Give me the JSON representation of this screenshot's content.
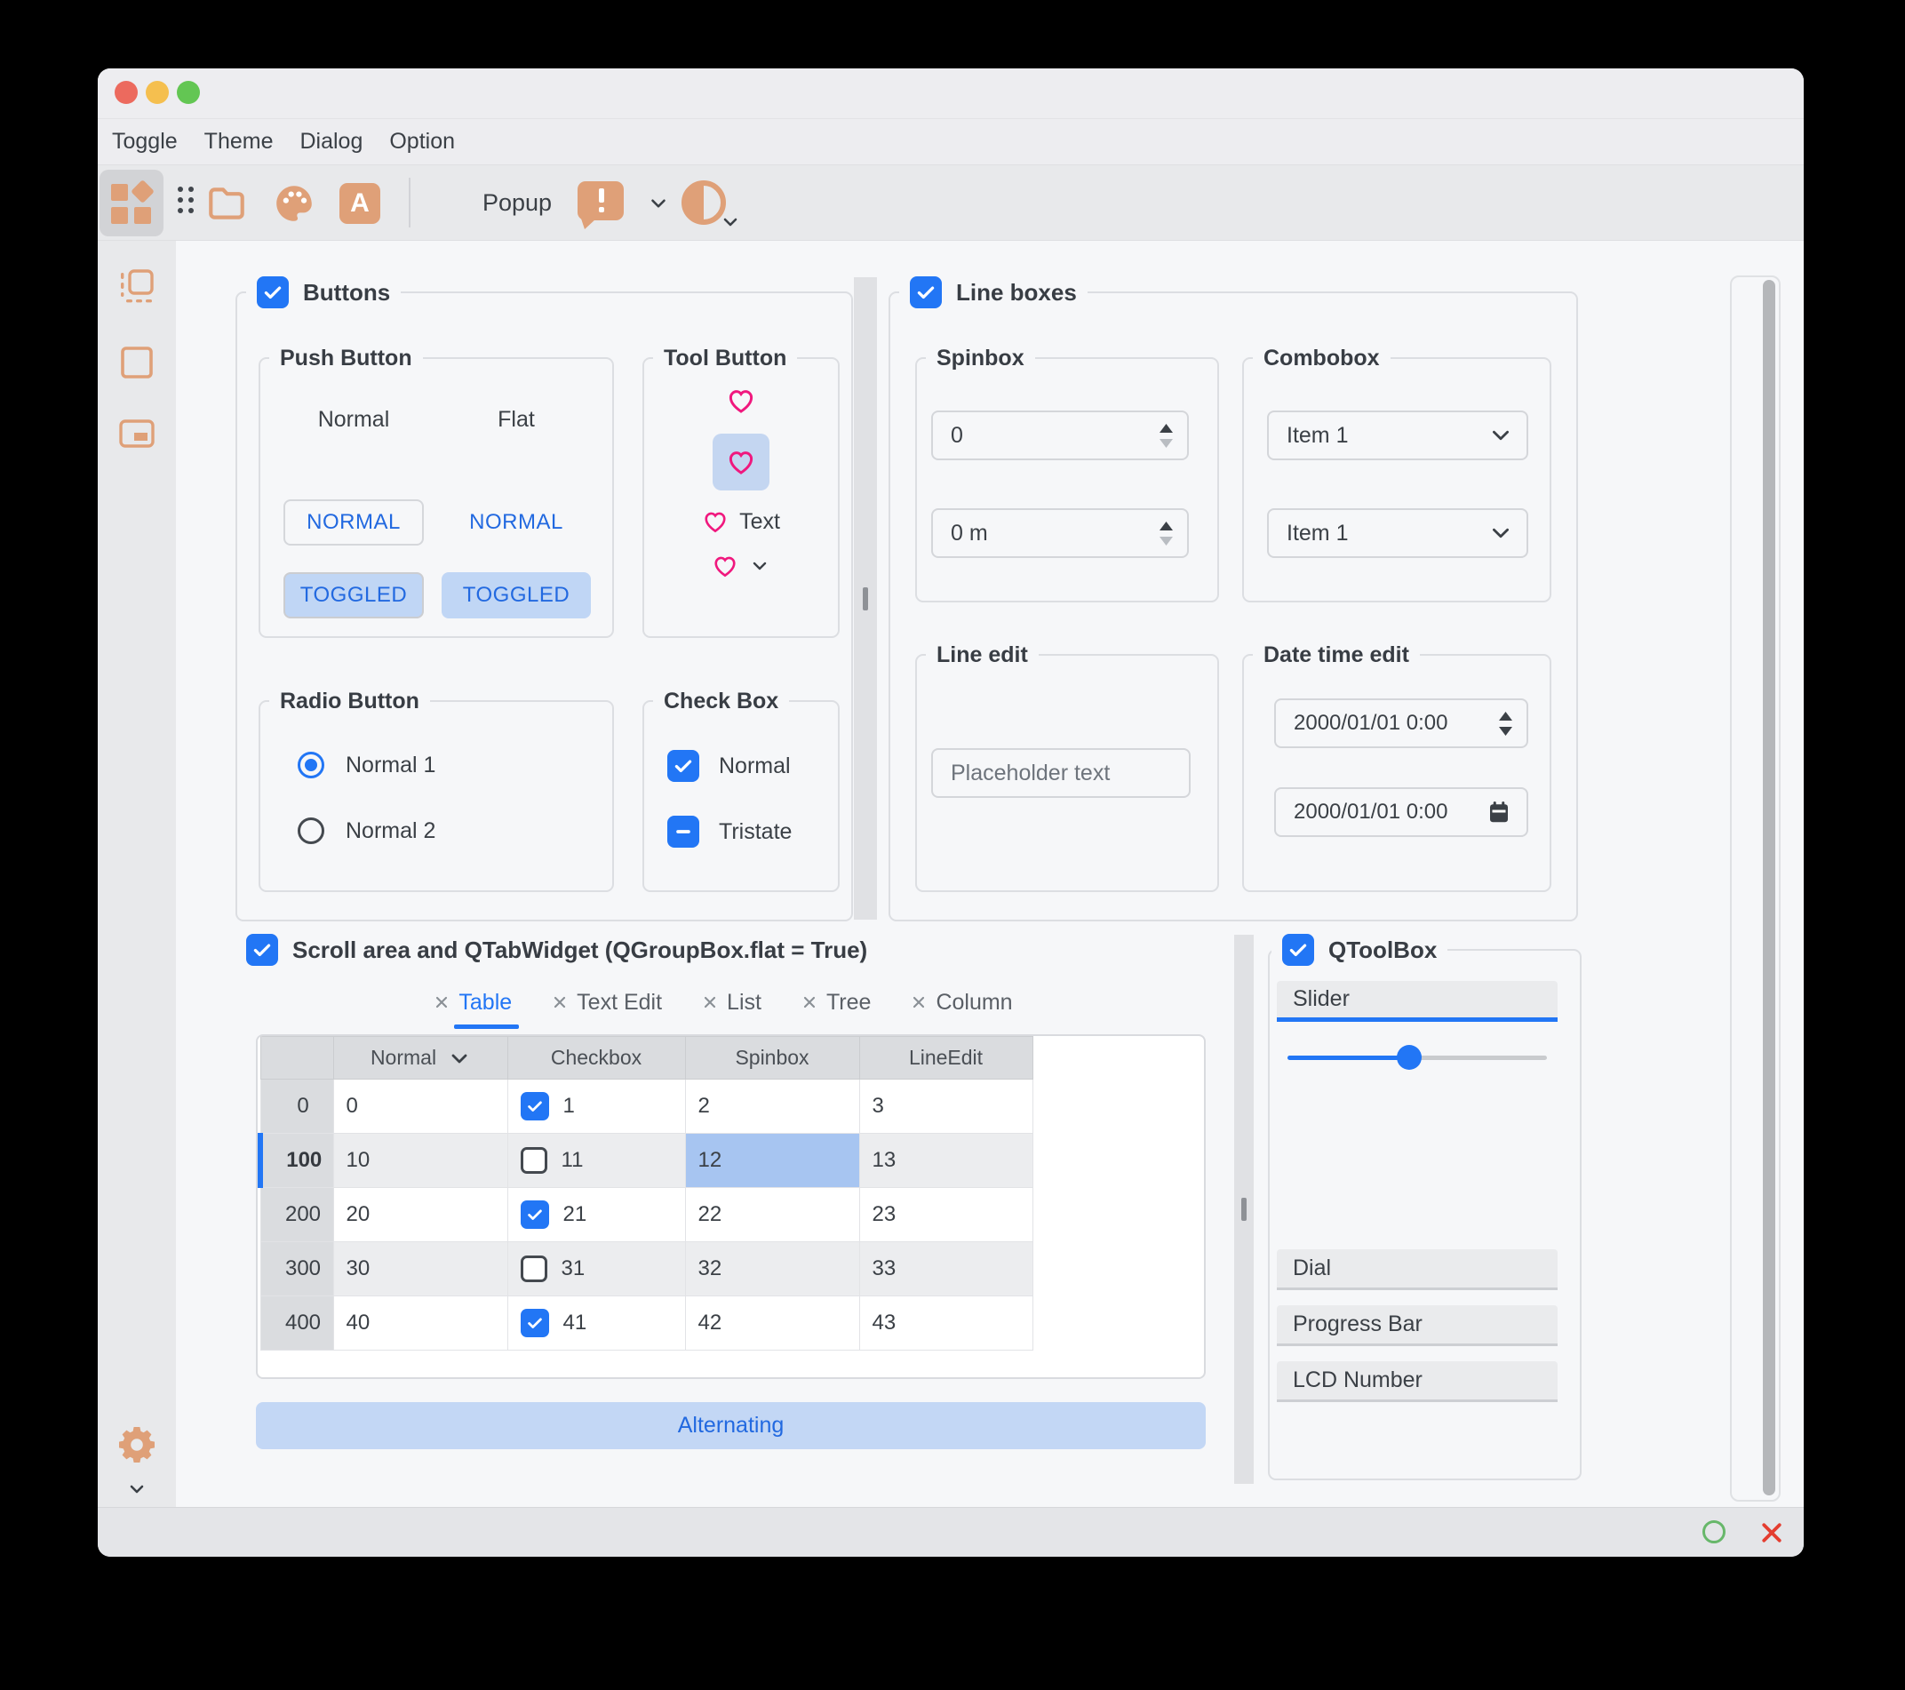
{
  "menubar": {
    "items": [
      "Toggle",
      "Theme",
      "Dialog",
      "Option"
    ]
  },
  "toolbar": {
    "popup_label": "Popup",
    "font_icon_letter": "A"
  },
  "buttons_group": {
    "title": "Buttons",
    "push_button": {
      "title": "Push Button",
      "normal_label": "Normal",
      "flat_label": "Flat",
      "normal_button": "NORMAL",
      "normal_flat_button": "NORMAL",
      "toggled_button": "TOGGLED",
      "toggled_flat_button": "TOGGLED"
    },
    "tool_button": {
      "title": "Tool Button",
      "text_button_label": "Text"
    },
    "radio_button": {
      "title": "Radio Button",
      "option_1": "Normal 1",
      "option_2": "Normal 2"
    },
    "check_box": {
      "title": "Check Box",
      "normal_label": "Normal",
      "tristate_label": "Tristate"
    }
  },
  "line_boxes_group": {
    "title": "Line boxes",
    "spinbox": {
      "title": "Spinbox",
      "value_1": "0",
      "value_2": "0 m"
    },
    "combobox": {
      "title": "Combobox",
      "value_1": "Item 1",
      "value_2": "Item 1"
    },
    "line_edit": {
      "title": "Line edit",
      "placeholder": "Placeholder text"
    },
    "date_time_edit": {
      "title": "Date time edit",
      "value_1": "2000/01/01 0:00",
      "value_2": "2000/01/01 0:00"
    }
  },
  "scroll_group": {
    "title": "Scroll area and QTabWidget (QGroupBox.flat = True)",
    "tabs": [
      {
        "label": "Table",
        "active": true
      },
      {
        "label": "Text Edit",
        "active": false
      },
      {
        "label": "List",
        "active": false
      },
      {
        "label": "Tree",
        "active": false
      },
      {
        "label": "Column",
        "active": false
      }
    ],
    "table": {
      "columns": [
        "Normal",
        "Checkbox",
        "Spinbox",
        "LineEdit"
      ],
      "rows": [
        {
          "header": "0",
          "normal": "0",
          "checkbox": "1",
          "checked": true,
          "spinbox": "2",
          "lineedit": "3"
        },
        {
          "header": "100",
          "normal": "10",
          "checkbox": "11",
          "checked": false,
          "spinbox": "12",
          "lineedit": "13"
        },
        {
          "header": "200",
          "normal": "20",
          "checkbox": "21",
          "checked": true,
          "spinbox": "22",
          "lineedit": "23"
        },
        {
          "header": "300",
          "normal": "30",
          "checkbox": "31",
          "checked": false,
          "spinbox": "32",
          "lineedit": "33"
        },
        {
          "header": "400",
          "normal": "40",
          "checkbox": "41",
          "checked": true,
          "spinbox": "42",
          "lineedit": "43"
        }
      ],
      "selected_cell": {
        "row": "100",
        "column": "Spinbox",
        "value": "12"
      }
    },
    "alternating_button": "Alternating"
  },
  "toolbox_group": {
    "title": "QToolBox",
    "sections": [
      {
        "label": "Slider",
        "active": true
      },
      {
        "label": "Dial",
        "active": false
      },
      {
        "label": "Progress Bar",
        "active": false
      },
      {
        "label": "LCD Number",
        "active": false
      }
    ],
    "slider_percent": 47
  },
  "icons": {
    "toolbar": [
      "widgets-icon",
      "drag-handle-icon",
      "folder-icon",
      "palette-icon",
      "font-icon",
      "message-exclamation-icon",
      "chevron-down-icon",
      "contrast-icon"
    ],
    "sidebar": [
      "frame-inspect-icon",
      "square-outline-icon",
      "picture-in-picture-icon",
      "settings-gear-icon",
      "chevron-down-icon"
    ],
    "statusbar": [
      "ok-circle-icon",
      "close-x-icon"
    ],
    "tool_buttons": "heart-icon"
  },
  "colors": {
    "accent_blue": "#2276F5",
    "button_text_blue": "#2269E0",
    "toggled_bg": "#C0D6F5",
    "selected_cell_bg": "#A7C5F1",
    "heart_pink": "#F0187E",
    "icon_orange": "#DFA078",
    "traffic_red": "#EC6A5E",
    "traffic_yellow": "#F5BF4F",
    "traffic_green": "#63C653",
    "ok_green": "#67B76A",
    "cancel_red": "#E43D30"
  }
}
